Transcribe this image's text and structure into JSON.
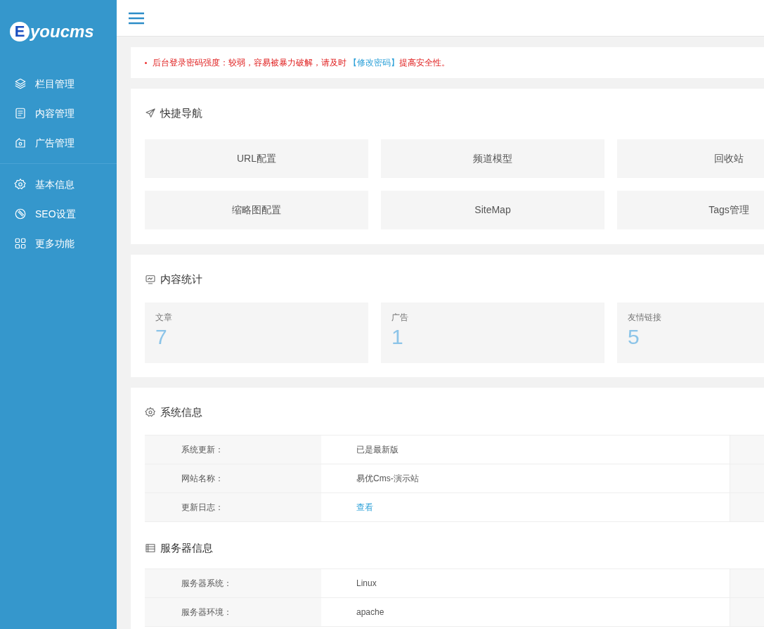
{
  "logo": {
    "letter": "E",
    "text": "youcms"
  },
  "sidebar": {
    "groups": [
      {
        "items": [
          {
            "label": "栏目管理",
            "selected": false
          },
          {
            "label": "内容管理",
            "selected": false
          },
          {
            "label": "广告管理",
            "selected": false
          }
        ]
      },
      {
        "items": [
          {
            "label": "基本信息",
            "selected": false
          },
          {
            "label": "SEO设置",
            "selected": false
          },
          {
            "label": "更多功能",
            "selected": false
          }
        ]
      }
    ]
  },
  "alert": {
    "before": "后台登录密码强度：较弱，容易被暴力破解，请及时",
    "link": "【修改密码】",
    "after": "提高安全性。"
  },
  "quick_nav": {
    "title": "快捷导航",
    "items": [
      "URL配置",
      "频道模型",
      "回收站",
      "缩略图配置",
      "SiteMap",
      "Tags管理"
    ]
  },
  "stats": {
    "title": "内容统计",
    "items": [
      {
        "label": "文章",
        "value": "7"
      },
      {
        "label": "广告",
        "value": "1"
      },
      {
        "label": "友情链接",
        "value": "5"
      }
    ]
  },
  "system_info": {
    "title": "系统信息",
    "rows": [
      {
        "label": "系统更新：",
        "value": "已是最新版",
        "kind": "text"
      },
      {
        "label": "网站名称：",
        "value": "易优Cms-演示站",
        "kind": "text"
      },
      {
        "label": "更新日志：",
        "value": "查看",
        "kind": "link"
      }
    ]
  },
  "server_info": {
    "title": "服务器信息",
    "rows": [
      {
        "label": "服务器系统：",
        "value": "Linux",
        "kind": "text"
      },
      {
        "label": "服务器环境：",
        "value": "apache",
        "kind": "text"
      }
    ]
  }
}
